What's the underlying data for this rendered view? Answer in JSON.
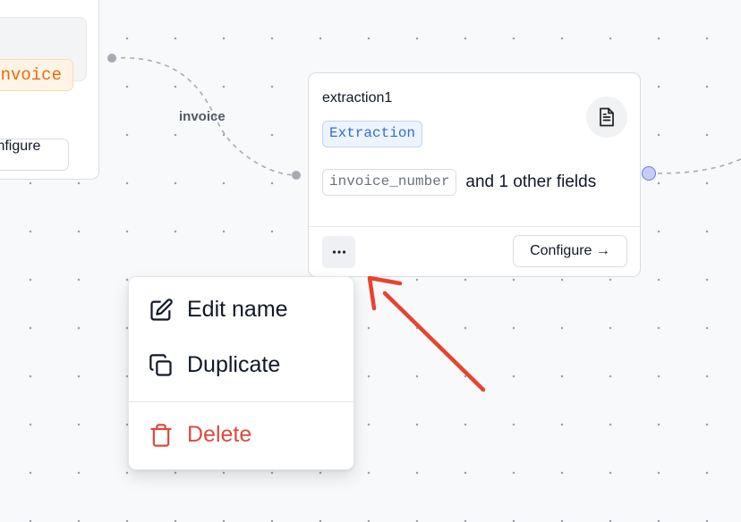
{
  "left_node": {
    "tag": "Invoice",
    "configure_label": "Configure →"
  },
  "edge": {
    "label": "invoice"
  },
  "node": {
    "title": "extraction1",
    "type_tag": "Extraction",
    "field_chip": "invoice_number",
    "fields_more": "and 1 other fields",
    "more_button_label": "···",
    "configure_label": "Configure →",
    "icon": "document-icon"
  },
  "context_menu": {
    "items": [
      {
        "label": "Edit name",
        "icon": "edit-icon"
      },
      {
        "label": "Duplicate",
        "icon": "duplicate-icon"
      },
      {
        "label": "Delete",
        "icon": "trash-icon"
      }
    ]
  },
  "colors": {
    "background": "#f8f9fb",
    "accent_blue": "#2f6fd6",
    "accent_orange": "#ea6a0c",
    "danger": "#d84b3f",
    "annotation_arrow": "#e8432c",
    "handle": "#c7cdf7"
  }
}
